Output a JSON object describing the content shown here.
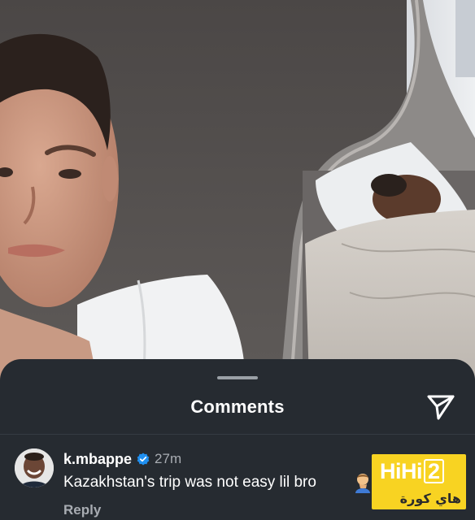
{
  "sheet": {
    "title": "Comments",
    "share_icon": "send-paper-plane-icon"
  },
  "comment": {
    "username": "k.mbappe",
    "verified": true,
    "verified_icon": "verified-badge-icon",
    "timestamp": "27m",
    "text": "Kazakhstan's trip was not easy lil bro",
    "emoji": "man-facepalming-emoji",
    "reply_label": "Reply"
  },
  "watermark": {
    "latin": "HiHi",
    "number": "2",
    "arabic": "هاي كورة"
  },
  "colors": {
    "sheet_bg": "#262b31",
    "text_primary": "#ffffff",
    "text_secondary": "#a8acb2",
    "verified_blue": "#1f8ff0",
    "watermark_yellow": "#f8d322"
  }
}
